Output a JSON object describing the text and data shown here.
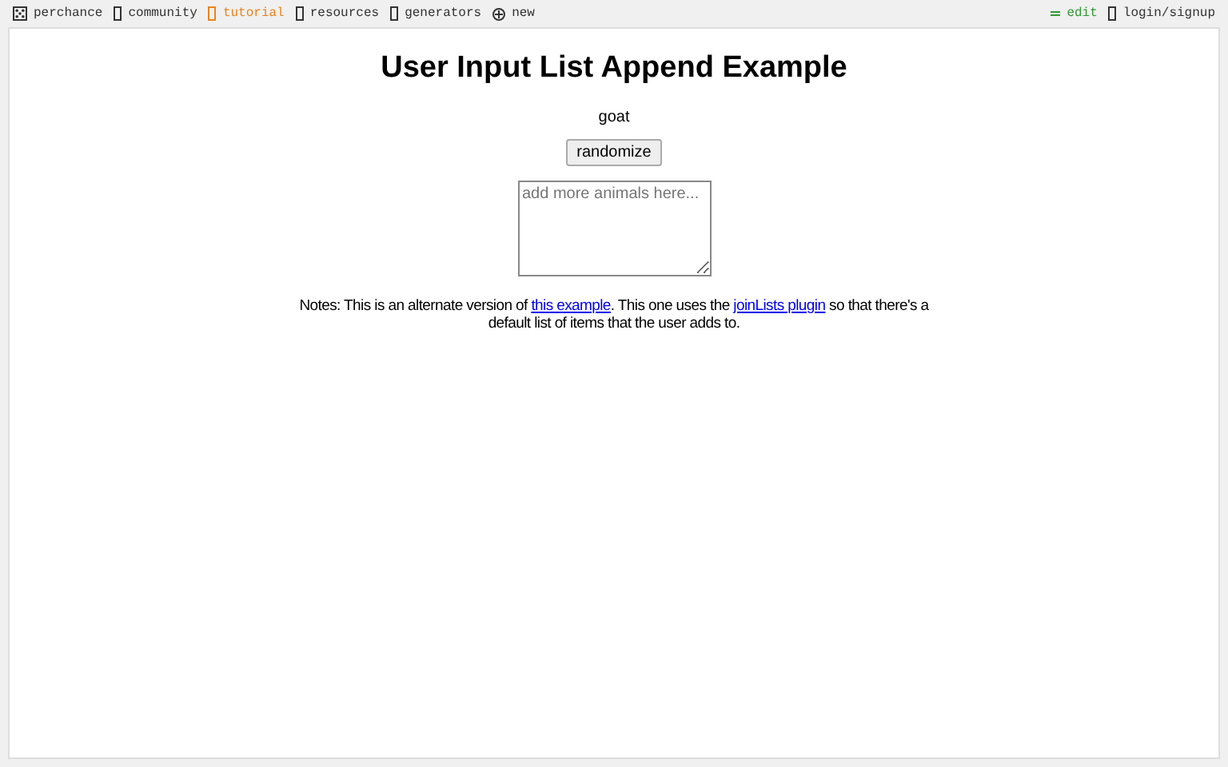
{
  "nav": {
    "left": [
      {
        "label": "perchance",
        "kind": "logo",
        "selected": false
      },
      {
        "label": "community",
        "kind": "link",
        "selected": false
      },
      {
        "label": "tutorial",
        "kind": "link",
        "selected": true
      },
      {
        "label": "resources",
        "kind": "link",
        "selected": false
      },
      {
        "label": "generators",
        "kind": "link",
        "selected": false
      },
      {
        "label": "new",
        "kind": "new",
        "selected": false
      }
    ],
    "right": [
      {
        "label": "edit",
        "kind": "edit"
      },
      {
        "label": "login/signup",
        "kind": "link"
      }
    ]
  },
  "page": {
    "title": "User Input List Append Example",
    "output": "goat",
    "button": "randomize",
    "textarea": {
      "placeholder": "add more animals here..."
    },
    "notes": [
      {
        "kind": "text",
        "text": "Notes: This is an alternate version of "
      },
      {
        "kind": "link",
        "text": "this example"
      },
      {
        "kind": "text",
        "text": ". This one uses the "
      },
      {
        "kind": "link",
        "text": "joinLists plugin"
      },
      {
        "kind": "text",
        "text": " so that there's a default list of items that the user adds to."
      }
    ]
  }
}
